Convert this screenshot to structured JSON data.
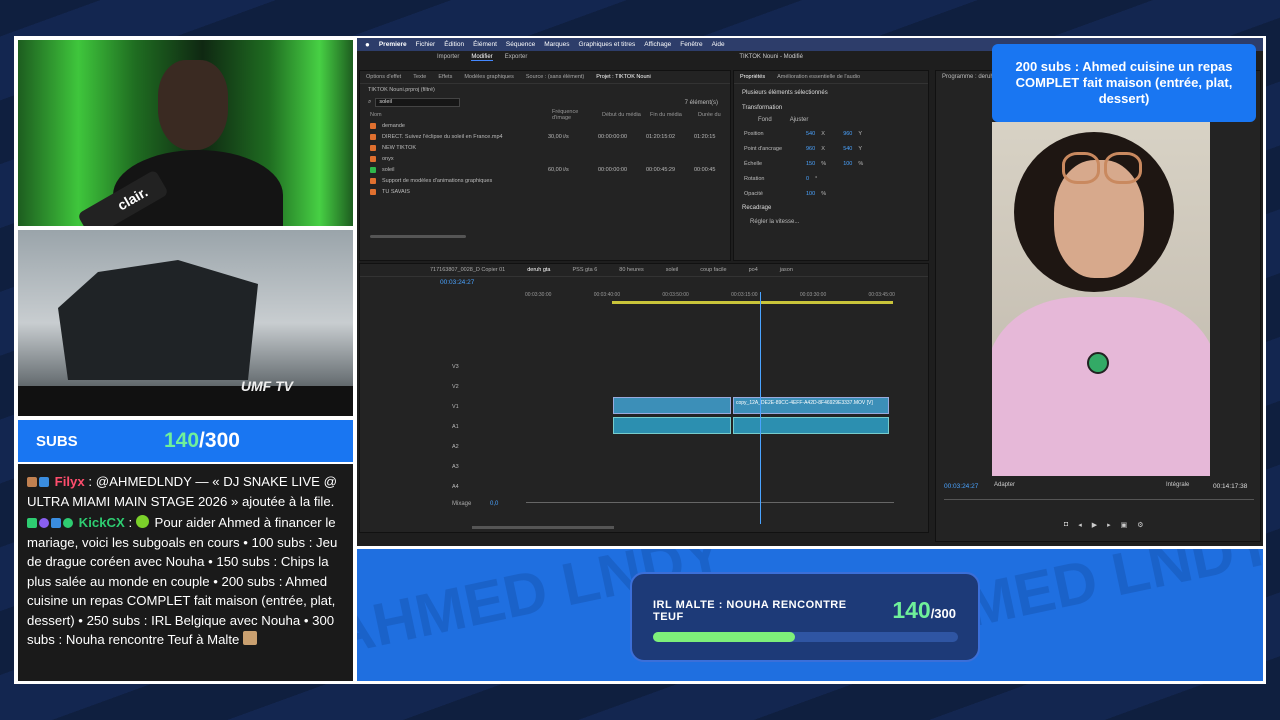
{
  "subs": {
    "label": "SUBS",
    "current": "140",
    "separator": "/",
    "goal": "300",
    "fraction": 0.4667
  },
  "chat": {
    "messages": [
      {
        "user": "Filyx",
        "sep": " : ",
        "text": "@AHMEDLNDY — « DJ SNAKE LIVE @ ULTRA MIAMI MAIN STAGE 2026 » ajoutée à la file."
      },
      {
        "user": "KickCX",
        "sep": " : ",
        "text": "Pour aider Ahmed à financer le mariage, voici les subgoals en cours • 100 subs : Jeu de drague coréen avec Nouha • 150 subs : Chips la plus salée au monde en couple • 200 subs : Ahmed cuisine un repas COMPLET fait maison (entrée, plat, dessert) • 250 subs : IRL Belgique avec Nouha • 300 subs : Nouha rencontre Teuf à Malte"
      }
    ]
  },
  "webcam": {
    "mic_label": "clair."
  },
  "stage": {
    "logo": "UMF TV"
  },
  "goal_card": {
    "text": "200 subs : Ahmed cuisine un repas COMPLET fait maison (entrée, plat, dessert)"
  },
  "premiere": {
    "menu": [
      "Premiere",
      "Fichier",
      "Édition",
      "Élément",
      "Séquence",
      "Marques",
      "Graphiques et titres",
      "Affichage",
      "Fenêtre",
      "Aide"
    ],
    "title": "TIKTOK Nouni - Modifié",
    "modes": [
      "Importer",
      "Modifier",
      "Exporter"
    ],
    "left_tabs": [
      "Options d'effet",
      "Texte",
      "Effets",
      "Modèles graphiques",
      "Source : (sans élément)",
      "Projet : TIKTOK Nouni"
    ],
    "project_name": "TIKTOK Nouni.prproj (filtré)",
    "search": "soleil",
    "item_count": "7 élément(s)",
    "columns": [
      "Nom",
      "Fréquence d'image",
      "Début du média",
      "Fin du média",
      "Durée du"
    ],
    "files": [
      {
        "name": "demande",
        "fps": "",
        "start": "",
        "end": "",
        "dur": "",
        "color": "#e0702f"
      },
      {
        "name": "DIRECT. Suivez l'éclipse du soleil en France.mp4",
        "fps": "30,00 i/s",
        "start": "00:00:00:00",
        "end": "01:20:15:02",
        "dur": "01:20:15",
        "color": "#e0702f"
      },
      {
        "name": "NEW TIKTOK",
        "fps": "",
        "start": "",
        "end": "",
        "dur": "",
        "color": "#e0702f"
      },
      {
        "name": "onyx",
        "fps": "",
        "start": "",
        "end": "",
        "dur": "",
        "color": "#e0702f"
      },
      {
        "name": "soleil",
        "fps": "60,00 i/s",
        "start": "00:00:00:00",
        "end": "00:00:45:29",
        "dur": "00:00:45",
        "color": "#2fb84c"
      },
      {
        "name": "Support de modèles d'animations graphiques",
        "fps": "",
        "start": "",
        "end": "",
        "dur": "",
        "color": "#e0702f"
      },
      {
        "name": "TU SAVAIS",
        "fps": "",
        "start": "",
        "end": "",
        "dur": "",
        "color": "#e0702f"
      }
    ],
    "props_tabs": [
      "Propriétés",
      "Amélioration essentielle de l'audio"
    ],
    "props": {
      "header": "Plusieurs éléments sélectionnés",
      "section": "Transformation",
      "fit": [
        "Fond",
        "Ajuster"
      ],
      "rows": [
        {
          "label": "Position",
          "v1": "540",
          "u1": "X",
          "v2": "960",
          "u2": "Y"
        },
        {
          "label": "Point d'ancrage",
          "v1": "960",
          "u1": "X",
          "v2": "540",
          "u2": "Y"
        },
        {
          "label": "Échelle",
          "v1": "150",
          "u1": "%",
          "v2": "100",
          "u2": "%"
        },
        {
          "label": "Rotation",
          "v1": "0",
          "u1": "°",
          "v2": "",
          "u2": ""
        },
        {
          "label": "Opacité",
          "v1": "100",
          "u1": "%",
          "v2": "",
          "u2": ""
        }
      ],
      "section2": "Recadrage",
      "speed_btn": "Régler la vitesse..."
    },
    "program_label": "Programme : deruh g",
    "seq_tabs": [
      "717163807_0028_D Copier 01",
      "deruh gta",
      "PSS gta 6",
      "80 heures",
      "soleil",
      "coup facile",
      "po4",
      "jason"
    ],
    "timecode": "00:03:24:27",
    "ruler": [
      "00:03:30:00",
      "00:03:40:00",
      "00:03:50:00",
      "00:03:15:00",
      "00:03:30:00",
      "00:03:45:00"
    ],
    "tracks": [
      "V3",
      "V2",
      "V1",
      "A1",
      "A2",
      "A3",
      "A4"
    ],
    "mixage": "Mixage",
    "mixage_val": "0,0",
    "clip_name": "copy_12A_DE2E-89CC-4EFF-A42D-8F46929E3337.MOV [V]",
    "program": {
      "timecode": "00:03:24:27",
      "fit": "Adapter",
      "quality": "Intégrale",
      "duration": "00:14:17:38"
    }
  },
  "banner": {
    "title": "IRL MALTE : NOUHA RENCONTRE TEUF",
    "current": "140",
    "total": "/300",
    "fraction": 0.4667,
    "watermark": "AHMED LNDY"
  }
}
